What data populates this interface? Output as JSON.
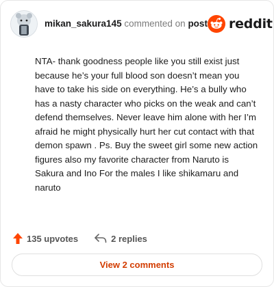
{
  "header": {
    "username": "mikan_sakura145",
    "commented_on": "commented on",
    "post_link": "post",
    "logo_text": "reddit"
  },
  "comment": {
    "text": "NTA- thank goodness people like you still exist just because he’s your full blood son doesn’t mean you have to take his side on everything. He’s a bully who has a nasty character who picks on the weak and can’t defend themselves. Never leave him alone with her I’m afraid he might physically hurt her cut contact with that demon spawn . Ps. Buy the sweet girl some new action figures also my favorite character from Naruto is Sakura and Ino For the males I like shikamaru and naruto"
  },
  "actions": {
    "upvotes": "135 upvotes",
    "replies": "2 replies"
  },
  "footer": {
    "view_comments": "View 2 comments"
  },
  "colors": {
    "brand": "#ff4500",
    "view_button_text": "#d23c00"
  },
  "icons": {
    "avatar": "avatar-icon",
    "logo": "reddit-logo-icon",
    "upvote": "upvote-arrow-icon",
    "reply": "reply-arrow-icon"
  }
}
